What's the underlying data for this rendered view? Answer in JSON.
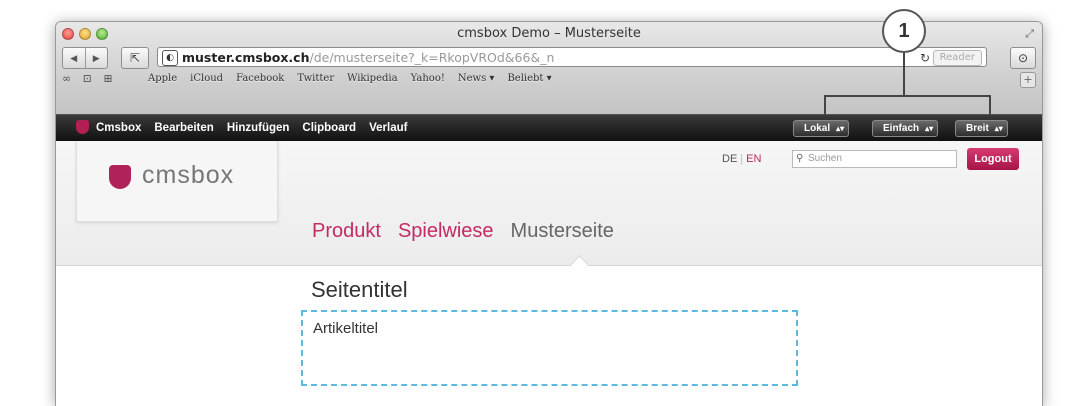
{
  "callout": {
    "number": "1"
  },
  "window": {
    "title": "cmsbox Demo – Musterseite",
    "url_host": "muster.cmsbox.ch",
    "url_path": "/de/musterseite?_k=RkopVROd&66&_n",
    "reader_label": "Reader"
  },
  "bookmarks": [
    "Apple",
    "iCloud",
    "Facebook",
    "Twitter",
    "Wikipedia",
    "Yahoo!",
    "News ▾",
    "Beliebt ▾"
  ],
  "cms_bar": {
    "brand": "Cmsbox",
    "menu": [
      "Bearbeiten",
      "Hinzufügen",
      "Clipboard",
      "Verlauf"
    ],
    "selects": [
      "Lokal",
      "Einfach",
      "Breit"
    ]
  },
  "site": {
    "logo_text": "cmsbox",
    "lang_de": "DE",
    "lang_en": "EN",
    "search_placeholder": "Suchen",
    "logout_label": "Logout",
    "tabs": [
      "Produkt",
      "Spielwiese",
      "Musterseite"
    ],
    "page_title": "Seitentitel",
    "article_title": "Artikeltitel"
  },
  "colors": {
    "accent": "#c0245f",
    "dashed_border": "#5db9df",
    "cms_bar": "#1a1a1a"
  }
}
